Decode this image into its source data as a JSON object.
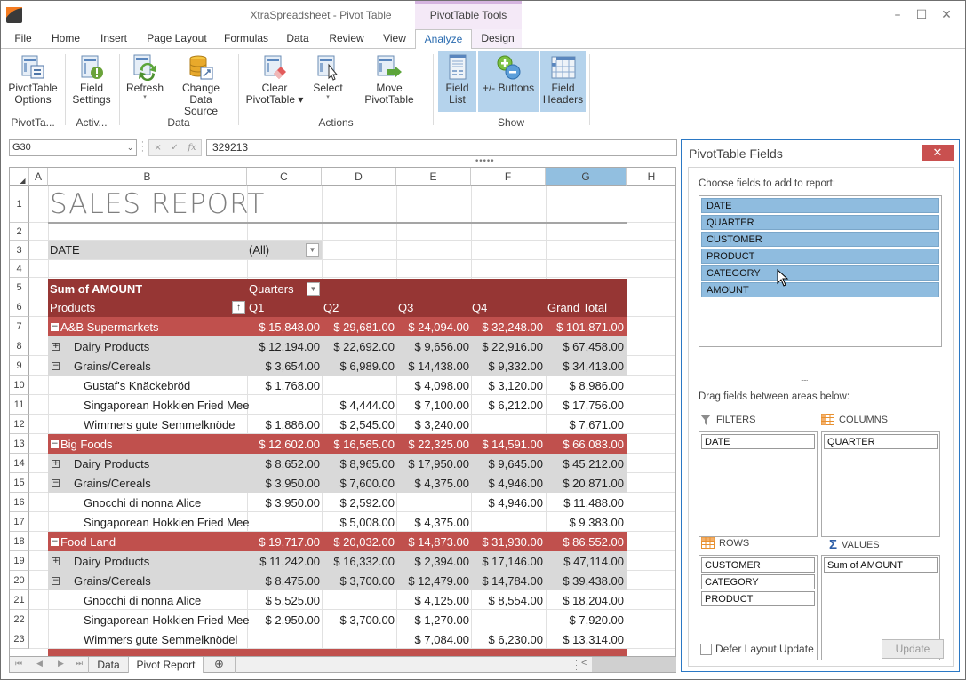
{
  "window": {
    "title": "XtraSpreadsheet - Pivot Table",
    "context_tab_title": "PivotTable Tools",
    "minimize": "–",
    "maximize": "☐",
    "close": "✕",
    "collapse_ribbon": "^"
  },
  "tabs": [
    {
      "label": "File"
    },
    {
      "label": "Home"
    },
    {
      "label": "Insert"
    },
    {
      "label": "Page Layout"
    },
    {
      "label": "Formulas"
    },
    {
      "label": "Data"
    },
    {
      "label": "Review"
    },
    {
      "label": "View"
    },
    {
      "label": "Analyze",
      "active": true
    },
    {
      "label": "Design"
    }
  ],
  "ribbon": {
    "buttons": {
      "pivottable_options": {
        "line1": "PivotTable",
        "line2": "Options"
      },
      "field_settings": {
        "line1": "Field",
        "line2": "Settings"
      },
      "refresh": {
        "line1": "Refresh",
        "dropdown": "▾"
      },
      "change_data_source": {
        "line1": "Change Data",
        "line2": "Source"
      },
      "clear_pivottable": {
        "line1": "Clear",
        "line2": "PivotTable ▾"
      },
      "select": {
        "line1": "Select",
        "dropdown": "▾"
      },
      "move_pivottable": {
        "line1": "Move PivotTable"
      },
      "field_list": {
        "line1": "Field",
        "line2": "List",
        "active": true
      },
      "plus_minus_buttons": {
        "line1": "+/- Buttons",
        "active": true
      },
      "field_headers": {
        "line1": "Field",
        "line2": "Headers",
        "active": true
      }
    },
    "groups": {
      "pivottable": "PivotTa...",
      "active_field": "Activ...",
      "data": "Data",
      "actions": "Actions",
      "show": "Show"
    }
  },
  "formula_bar": {
    "name_box": "G30",
    "cancel": "×",
    "enter": "✓",
    "fx": "fx",
    "value": "329213"
  },
  "grid": {
    "columns": [
      "A",
      "B",
      "C",
      "D",
      "E",
      "F",
      "G",
      "H"
    ],
    "selected_column": "G",
    "rows": [
      "1",
      "2",
      "3",
      "4",
      "5",
      "6",
      "7",
      "8",
      "9",
      "10",
      "11",
      "12",
      "13",
      "14",
      "15",
      "16",
      "17",
      "18",
      "19",
      "20",
      "21",
      "22",
      "23"
    ],
    "sheet_title": "SALES REPORT",
    "filter": {
      "field": "DATE",
      "value": "(All)"
    },
    "pivot_header": {
      "values_label": "Sum of AMOUNT",
      "column_field": "Quarters",
      "row_field": "Products",
      "sort_icon": "↑",
      "column_labels": [
        "Q1",
        "Q2",
        "Q3",
        "Q4",
        "Grand Total"
      ]
    },
    "pivot_rows": [
      {
        "level": "customer",
        "toggle": "−",
        "label": "A&B Supermarkets",
        "values": [
          "$ 15,848.00",
          "$ 29,681.00",
          "$ 24,094.00",
          "$ 32,248.00",
          "$ 101,871.00"
        ]
      },
      {
        "level": "category",
        "toggle": "+",
        "label": "Dairy Products",
        "values": [
          "$ 12,194.00",
          "$ 22,692.00",
          "$ 9,656.00",
          "$ 22,916.00",
          "$ 67,458.00"
        ]
      },
      {
        "level": "category",
        "toggle": "−",
        "label": "Grains/Cereals",
        "values": [
          "$ 3,654.00",
          "$ 6,989.00",
          "$ 14,438.00",
          "$ 9,332.00",
          "$ 34,413.00"
        ]
      },
      {
        "level": "product",
        "label": "Gustaf's Knäckebröd",
        "values": [
          "$ 1,768.00",
          "",
          "$ 4,098.00",
          "$ 3,120.00",
          "$ 8,986.00"
        ]
      },
      {
        "level": "product",
        "label": "Singaporean Hokkien Fried Mee",
        "values": [
          "",
          "$ 4,444.00",
          "$ 7,100.00",
          "$ 6,212.00",
          "$ 17,756.00"
        ]
      },
      {
        "level": "product",
        "label": "Wimmers gute Semmelknöde",
        "values": [
          "$ 1,886.00",
          "$ 2,545.00",
          "$ 3,240.00",
          "",
          "$ 7,671.00"
        ]
      },
      {
        "level": "customer",
        "toggle": "−",
        "label": "Big Foods",
        "values": [
          "$ 12,602.00",
          "$ 16,565.00",
          "$ 22,325.00",
          "$ 14,591.00",
          "$ 66,083.00"
        ]
      },
      {
        "level": "category",
        "toggle": "+",
        "label": "Dairy Products",
        "values": [
          "$ 8,652.00",
          "$ 8,965.00",
          "$ 17,950.00",
          "$ 9,645.00",
          "$ 45,212.00"
        ]
      },
      {
        "level": "category",
        "toggle": "−",
        "label": "Grains/Cereals",
        "values": [
          "$ 3,950.00",
          "$ 7,600.00",
          "$ 4,375.00",
          "$ 4,946.00",
          "$ 20,871.00"
        ]
      },
      {
        "level": "product",
        "label": "Gnocchi di nonna Alice",
        "values": [
          "$ 3,950.00",
          "$ 2,592.00",
          "",
          "$ 4,946.00",
          "$ 11,488.00"
        ]
      },
      {
        "level": "product",
        "label": "Singaporean Hokkien Fried Mee",
        "values": [
          "",
          "$ 5,008.00",
          "$ 4,375.00",
          "",
          "$ 9,383.00"
        ]
      },
      {
        "level": "customer",
        "toggle": "−",
        "label": "Food Land",
        "values": [
          "$ 19,717.00",
          "$ 20,032.00",
          "$ 14,873.00",
          "$ 31,930.00",
          "$ 86,552.00"
        ]
      },
      {
        "level": "category",
        "toggle": "+",
        "label": "Dairy Products",
        "values": [
          "$ 11,242.00",
          "$ 16,332.00",
          "$ 2,394.00",
          "$ 17,146.00",
          "$ 47,114.00"
        ]
      },
      {
        "level": "category",
        "toggle": "−",
        "label": "Grains/Cereals",
        "values": [
          "$ 8,475.00",
          "$ 3,700.00",
          "$ 12,479.00",
          "$ 14,784.00",
          "$ 39,438.00"
        ]
      },
      {
        "level": "product",
        "label": "Gnocchi di nonna Alice",
        "values": [
          "$ 5,525.00",
          "",
          "$ 4,125.00",
          "$ 8,554.00",
          "$ 18,204.00"
        ]
      },
      {
        "level": "product",
        "label": "Singaporean Hokkien Fried Mee",
        "values": [
          "$ 2,950.00",
          "$ 3,700.00",
          "$ 1,270.00",
          "",
          "$ 7,920.00"
        ]
      },
      {
        "level": "product",
        "label": "Wimmers gute Semmelknödel",
        "values": [
          "",
          "",
          "$ 7,084.00",
          "$ 6,230.00",
          "$ 13,314.00"
        ]
      }
    ]
  },
  "sheet_tabs": {
    "nav": [
      "⏮",
      "◀",
      "▶",
      "⏭"
    ],
    "tabs": [
      {
        "label": "Data"
      },
      {
        "label": "Pivot Report",
        "active": true
      }
    ],
    "add": "⊕",
    "scroll_left": "<"
  },
  "pivot_panel": {
    "title": "PivotTable Fields",
    "close": "✕",
    "choose_label": "Choose fields to add to report:",
    "fields": [
      "DATE",
      "QUARTER",
      "CUSTOMER",
      "PRODUCT",
      "CATEGORY",
      "AMOUNT"
    ],
    "splitter": ".....",
    "drag_label": "Drag fields between areas below:",
    "areas": {
      "filters": {
        "label": "FILTERS",
        "items": [
          "DATE"
        ]
      },
      "columns": {
        "label": "COLUMNS",
        "items": [
          "QUARTER"
        ]
      },
      "rows": {
        "label": "ROWS",
        "items": [
          "CUSTOMER",
          "CATEGORY",
          "PRODUCT"
        ]
      },
      "values": {
        "label": "VALUES",
        "items": [
          "Sum of AMOUNT"
        ]
      }
    },
    "defer_label": "Defer Layout Update",
    "defer_checked": false,
    "update_label": "Update"
  },
  "colors": {
    "customer_row": "#c0504d",
    "header_row": "#963634",
    "category_row": "#d9d9d9",
    "field_item": "#8fbcdf",
    "accent": "#2b78c4",
    "close_button": "#c9504f"
  }
}
